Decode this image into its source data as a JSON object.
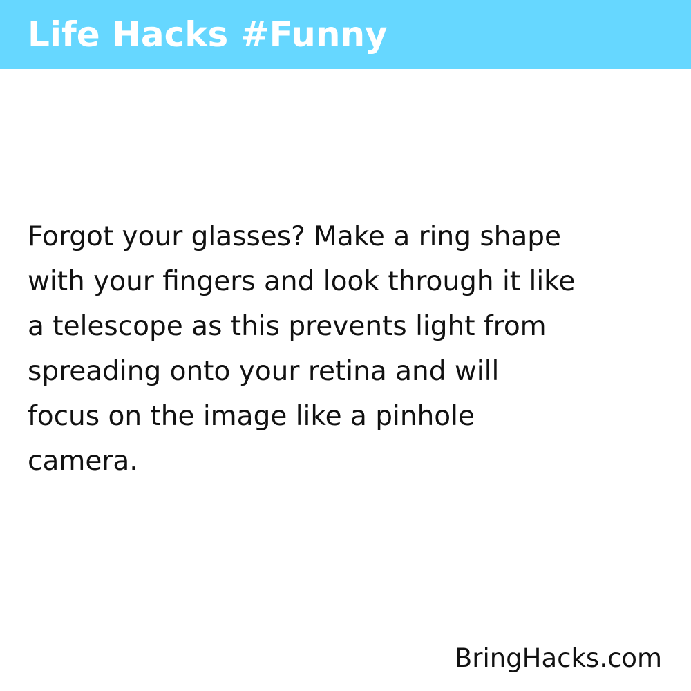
{
  "header": {
    "title": "Life Hacks #Funny",
    "background_color": "#66d7ff",
    "text_color": "#ffffff"
  },
  "hack": {
    "lines": [
      "Forgot your glasses? Make a ring shape",
      "with your fingers and look through it like",
      "a telescope as this prevents light from",
      "spreading onto your retina and will",
      "focus on the image like a pinhole",
      "camera."
    ]
  },
  "footer": {
    "site": "BringHacks.com"
  }
}
